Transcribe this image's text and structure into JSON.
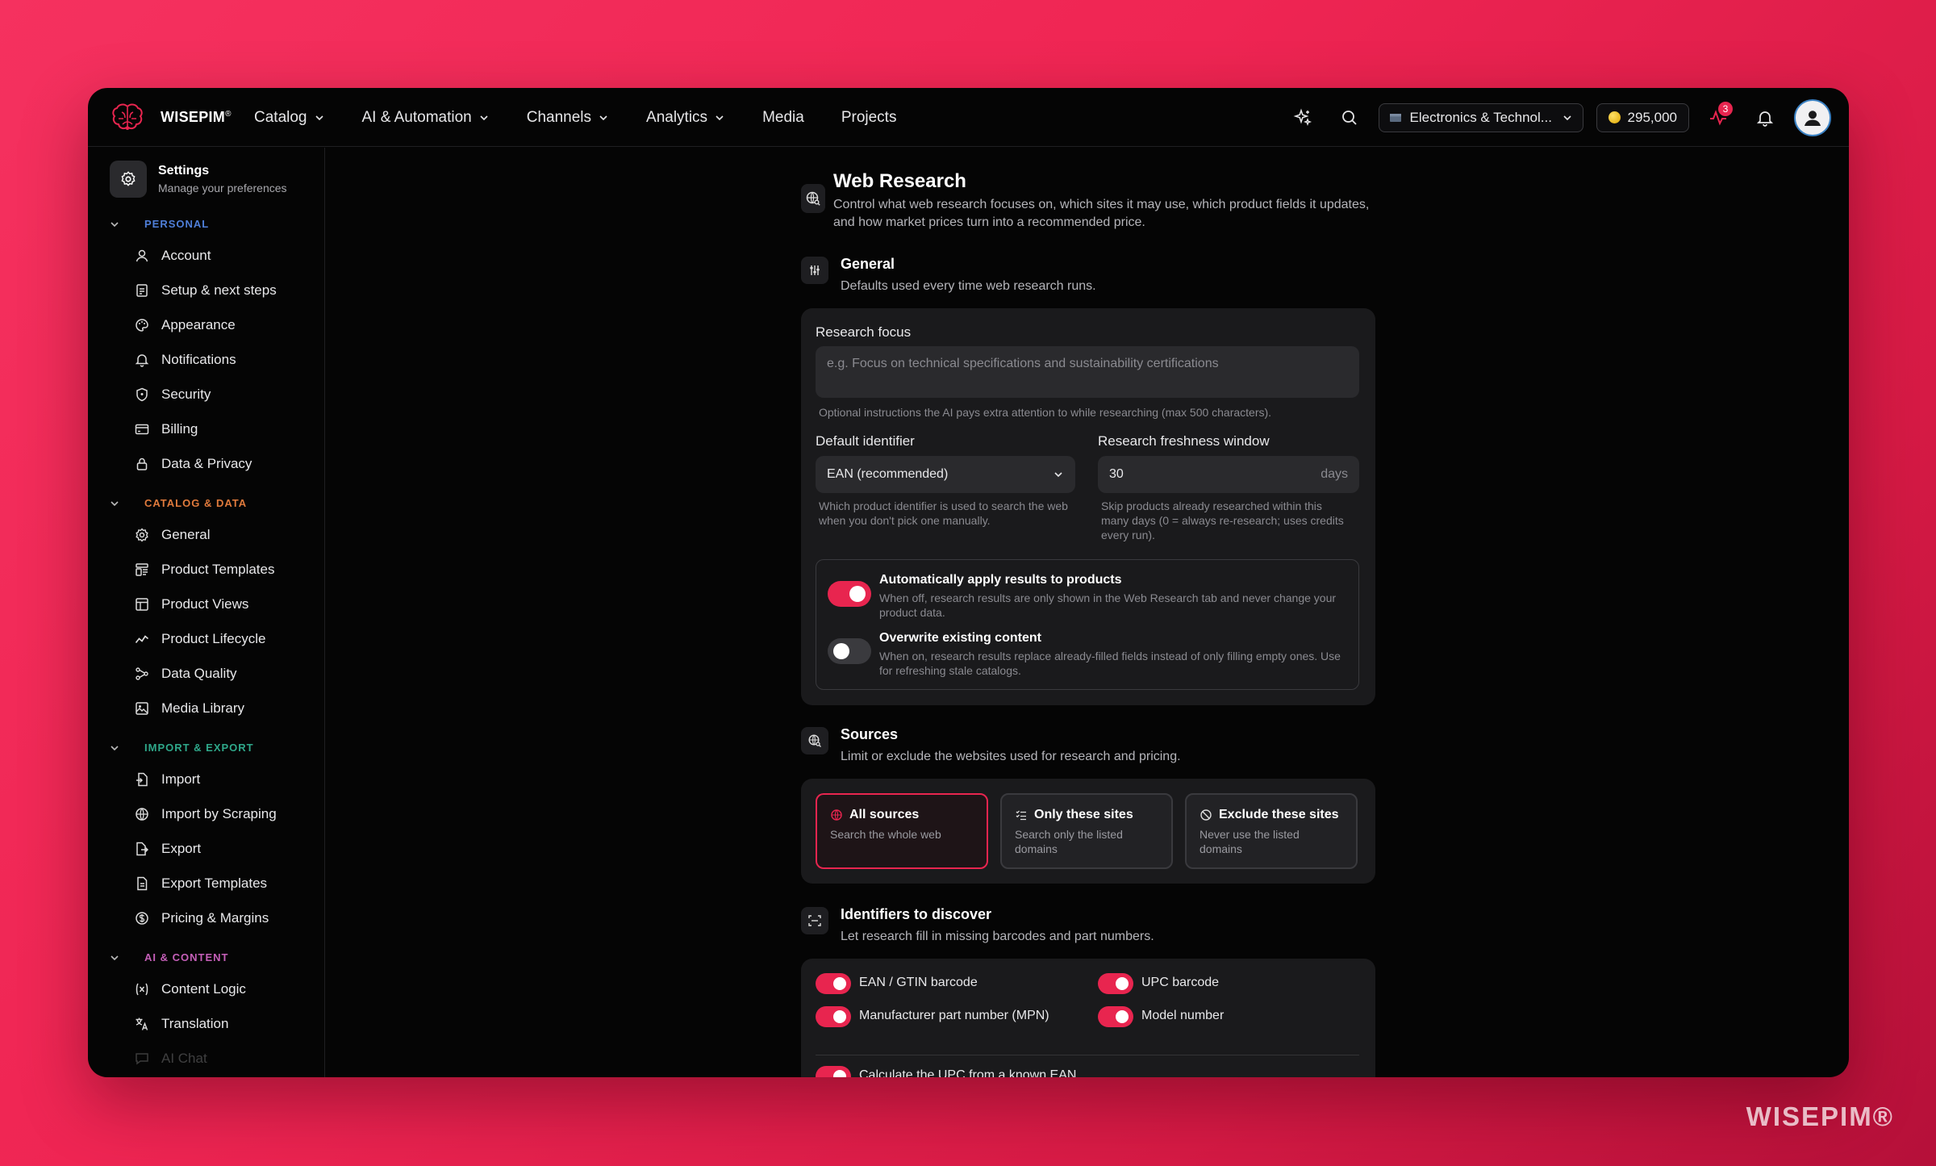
{
  "app": {
    "brand": "WISEPIM",
    "brand_mark": "®",
    "watermark": "WISEPIM®"
  },
  "nav": {
    "items": [
      "Catalog",
      "AI & Automation",
      "Channels",
      "Analytics",
      "Media",
      "Projects"
    ]
  },
  "topbar": {
    "channel": "Electronics & Technol...",
    "credits": "295,000",
    "activity_badge": "3",
    "icons": [
      "sparkle-icon",
      "search-icon",
      "activity-icon",
      "bell-icon",
      "user-icon"
    ]
  },
  "sidebar": {
    "title": "Settings",
    "subtitle": "Manage your preferences",
    "sections": [
      {
        "label": "PERSONAL",
        "color": "#4f7fd9",
        "items": [
          "Account",
          "Setup & next steps",
          "Appearance",
          "Notifications",
          "Security",
          "Billing",
          "Data & Privacy"
        ]
      },
      {
        "label": "CATALOG & DATA",
        "color": "#e07a3c",
        "items": [
          "General",
          "Product Templates",
          "Product Views",
          "Product Lifecycle",
          "Data Quality",
          "Media Library"
        ]
      },
      {
        "label": "IMPORT & EXPORT",
        "color": "#2fa88a",
        "items": [
          "Import",
          "Import by Scraping",
          "Export",
          "Export Templates",
          "Pricing & Margins"
        ]
      },
      {
        "label": "AI & CONTENT",
        "color": "#c55fb8",
        "items": [
          "Content Logic",
          "Translation",
          "AI Chat"
        ]
      }
    ]
  },
  "page": {
    "title": "Web Research",
    "description": "Control what web research focuses on, which sites it may use, which product fields it updates, and how market prices turn into a recommended price."
  },
  "general": {
    "title": "General",
    "subtitle": "Defaults used every time web research runs.",
    "focus_label": "Research focus",
    "focus_placeholder": "e.g. Focus on technical specifications and sustainability certifications",
    "focus_hint": "Optional instructions the AI pays extra attention to while researching (max 500 characters).",
    "identifier_label": "Default identifier",
    "identifier_value": "EAN (recommended)",
    "identifier_hint": "Which product identifier is used to search the web when you don't pick one manually.",
    "freshness_label": "Research freshness window",
    "freshness_value": "30",
    "freshness_unit": "days",
    "freshness_hint": "Skip products already researched within this many days (0 = always re-research; uses credits every run).",
    "auto_apply_title": "Automatically apply results to products",
    "auto_apply_desc": "When off, research results are only shown in the Web Research tab and never change your product data.",
    "auto_apply_on": true,
    "overwrite_title": "Overwrite existing content",
    "overwrite_desc": "When on, research results replace already-filled fields instead of only filling empty ones. Use for refreshing stale catalogs.",
    "overwrite_on": false
  },
  "sources": {
    "title": "Sources",
    "subtitle": "Limit or exclude the websites used for research and pricing.",
    "options": [
      {
        "title": "All sources",
        "desc": "Search the whole web",
        "selected": true
      },
      {
        "title": "Only these sites",
        "desc": "Search only the listed domains",
        "selected": false
      },
      {
        "title": "Exclude these sites",
        "desc": "Never use the listed domains",
        "selected": false
      }
    ]
  },
  "identifiers": {
    "title": "Identifiers to discover",
    "subtitle": "Let research fill in missing barcodes and part numbers.",
    "items": [
      {
        "label": "EAN / GTIN barcode",
        "on": true
      },
      {
        "label": "UPC barcode",
        "on": true
      },
      {
        "label": "Manufacturer part number (MPN)",
        "on": true
      },
      {
        "label": "Model number",
        "on": true
      }
    ],
    "calc_label": "Calculate the UPC from a known EAN"
  }
}
